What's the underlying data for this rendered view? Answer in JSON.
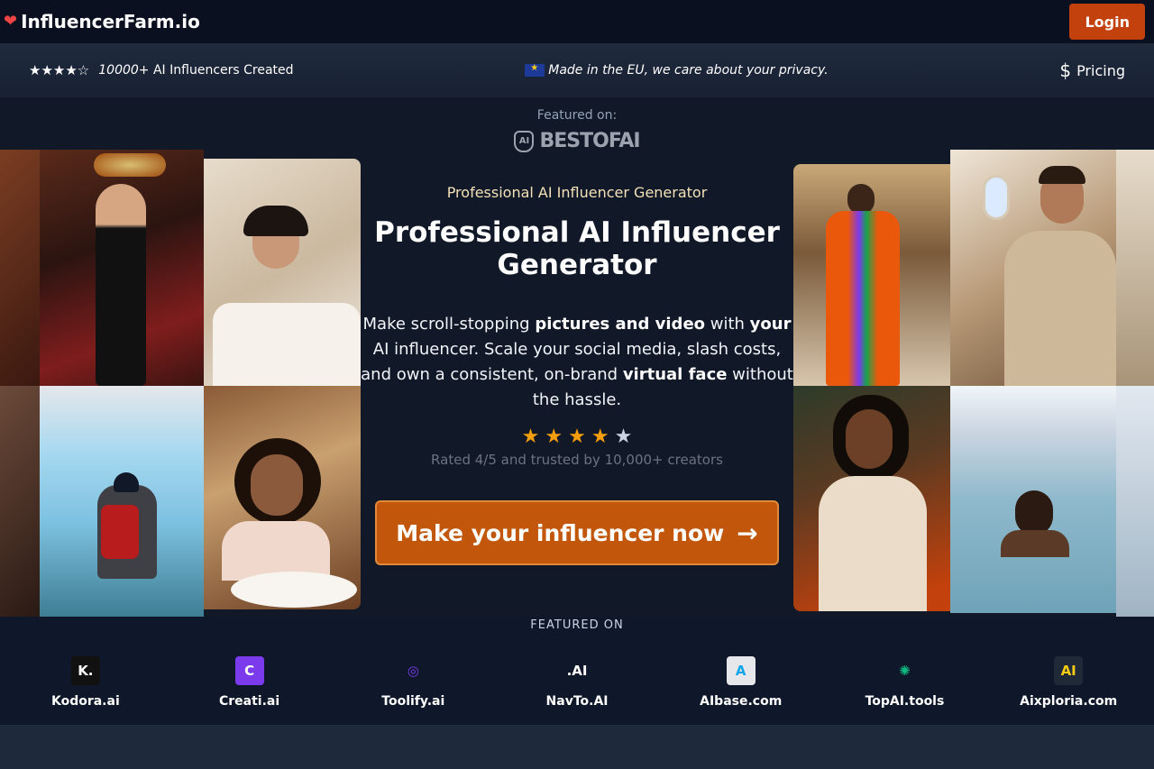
{
  "nav": {
    "brand": "InfluencerFarm.io",
    "login_label": "Login"
  },
  "infobar": {
    "rating_stars": "★★★★☆",
    "count_bold": "10000+",
    "count_text": " AI Influencers Created",
    "privacy_text": "Made in the EU, we care about your privacy.",
    "pricing_symbol": "$",
    "pricing_label": "Pricing"
  },
  "hero": {
    "featured_on_small": "Featured on:",
    "bestofai_left": "BEST",
    "bestofai_mid": "O",
    "bestofai_right": "F",
    "bestofai_end": "AI",
    "bestofai_badge": "AI",
    "subtitle": "Professional AI Influencer Generator",
    "title": "Professional AI Influencer Generator",
    "desc_1": "Make scroll-stopping ",
    "desc_b1": "pictures and video",
    "desc_2": " with ",
    "desc_b2": "your",
    "desc_3": " AI influencer. Scale your social media, slash costs, and own a consistent, on-brand ",
    "desc_b3": "virtual face",
    "desc_4": " without the hassle.",
    "rating_value": 4,
    "rating_max": 5,
    "rating_text": "Rated 4/5 and trusted by 10,000+ creators",
    "cta_label": "Make your influencer now",
    "cta_arrow": "→"
  },
  "featured": {
    "title": "FEATURED ON",
    "items": [
      {
        "name": "Kodora.ai",
        "logo_text": "K.",
        "bg": "#111111",
        "fg": "#ffffff",
        "icon": "kodora-logo-icon"
      },
      {
        "name": "Creati.ai",
        "logo_text": "C",
        "bg": "#7c3aed",
        "fg": "#ffffff",
        "icon": "creati-logo-icon"
      },
      {
        "name": "Toolify.ai",
        "logo_text": "◎",
        "bg": "#0f172a",
        "fg": "#7c3aed",
        "icon": "toolify-logo-icon"
      },
      {
        "name": "NavTo.AI",
        "logo_text": ".AI",
        "bg": "#0f172a",
        "fg": "#ffffff",
        "icon": "navto-logo-icon"
      },
      {
        "name": "AIbase.com",
        "logo_text": "A",
        "bg": "#e5e7eb",
        "fg": "#0ea5e9",
        "icon": "aibase-logo-icon"
      },
      {
        "name": "TopAI.tools",
        "logo_text": "✺",
        "bg": "#0f172a",
        "fg": "#10b981",
        "icon": "topai-logo-icon"
      },
      {
        "name": "Aixploria.com",
        "logo_text": "AI",
        "bg": "#1f2937",
        "fg": "#facc15",
        "icon": "aixploria-logo-icon"
      }
    ]
  },
  "colors": {
    "accent": "#c2410c",
    "cta": "#c2570c",
    "star": "#f59e0b",
    "nav_bg": "#0b1020"
  }
}
